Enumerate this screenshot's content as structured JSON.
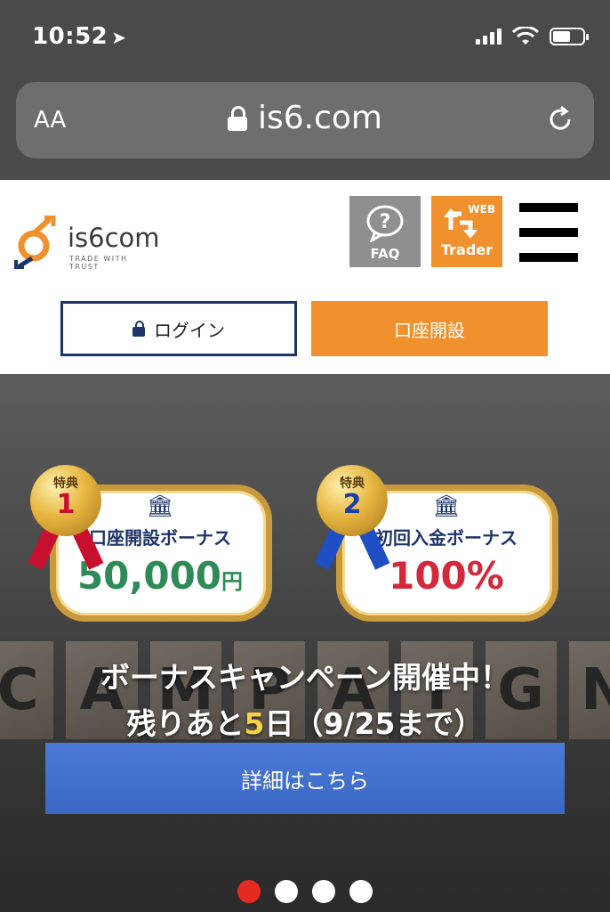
{
  "status_bar": {
    "time": "10:52",
    "location_icon": "location-arrow-icon",
    "signal_icon": "cellular-signal-icon",
    "wifi_icon": "wifi-icon",
    "battery_icon": "battery-icon",
    "battery_level": 0.6
  },
  "browser": {
    "text_size_label": "AA",
    "url": "is6.com",
    "lock_icon": "lock-icon",
    "reload_icon": "reload-icon"
  },
  "header": {
    "logo_text": "is6com",
    "logo_tagline": "TRADE WITH TRUST",
    "faq_label": "FAQ",
    "faq_icon": "question-bubble-icon",
    "trader_label": "Trader",
    "trader_web_label": "WEB",
    "trader_icon": "web-trader-arrows-icon",
    "menu_icon": "hamburger-menu-icon",
    "login_label": "ログイン",
    "open_account_label": "口座開設",
    "accent_orange": "#f0912e",
    "accent_navy": "#1d3569"
  },
  "hero": {
    "blocks": [
      "C",
      "A",
      "M",
      "P",
      "A",
      "I",
      "G",
      "N"
    ],
    "badges": [
      {
        "medal_label": "特典",
        "medal_number": "1",
        "bank_icon": "bank-icon",
        "title": "口座開設ボーナス",
        "value": "50,000",
        "unit": "円"
      },
      {
        "medal_label": "特典",
        "medal_number": "2",
        "bank_icon": "bank-icon",
        "title": "初回入金ボーナス",
        "value": "100%",
        "unit": ""
      }
    ],
    "headline": "ボーナスキャンペーン開催中！",
    "subline_prefix": "残りあと",
    "subline_days": "5",
    "subline_suffix": "日（9/25まで）",
    "detail_button_label": "詳細はこちら"
  },
  "carousel": {
    "total": 4,
    "active_index": 0,
    "active_color": "#e52a22"
  }
}
